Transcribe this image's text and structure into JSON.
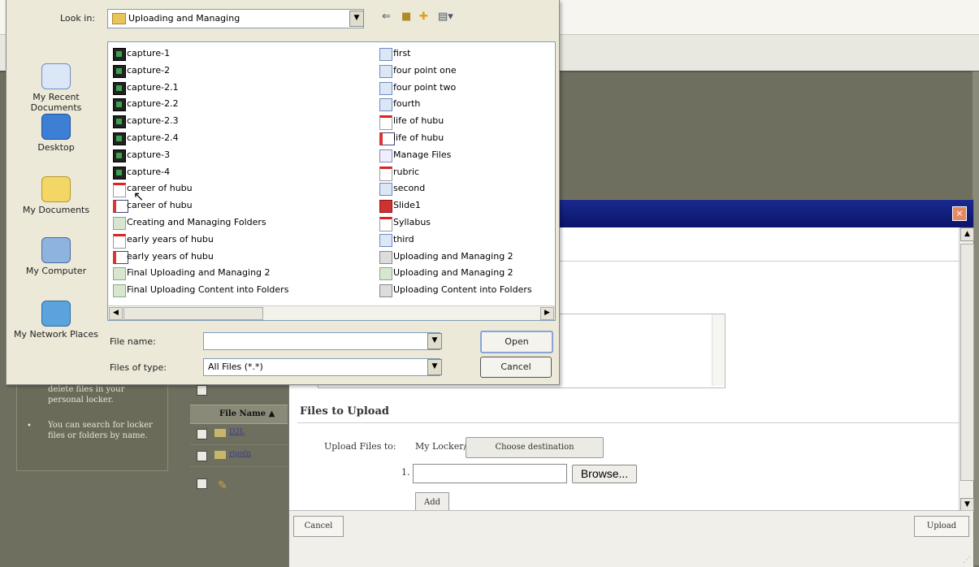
{
  "dialog": {
    "look_in_label": "Look in:",
    "look_in_value": "Uploading and Managing",
    "places": [
      {
        "label": "My Recent Documents"
      },
      {
        "label": "Desktop"
      },
      {
        "label": "My Documents"
      },
      {
        "label": "My Computer"
      },
      {
        "label": "My Network Places"
      }
    ],
    "files_left": [
      {
        "name": "capture-1",
        "type": "cap"
      },
      {
        "name": "capture-2",
        "type": "cap"
      },
      {
        "name": "capture-2.1",
        "type": "cap"
      },
      {
        "name": "capture-2.2",
        "type": "cap"
      },
      {
        "name": "capture-2.3",
        "type": "cap"
      },
      {
        "name": "capture-2.4",
        "type": "cap"
      },
      {
        "name": "capture-3",
        "type": "cap"
      },
      {
        "name": "capture-4",
        "type": "cap"
      },
      {
        "name": "career of hubu",
        "type": "pdf"
      },
      {
        "name": "career of hubu",
        "type": "ppt"
      },
      {
        "name": "Creating and Managing Folders",
        "type": "htm"
      },
      {
        "name": "early years of hubu",
        "type": "pdf"
      },
      {
        "name": "early years of hubu",
        "type": "ppt"
      },
      {
        "name": "Final Uploading and Managing 2",
        "type": "htm"
      },
      {
        "name": "Final Uploading Content into Folders",
        "type": "htm"
      }
    ],
    "files_right": [
      {
        "name": "first",
        "type": "aud"
      },
      {
        "name": "four point one",
        "type": "aud"
      },
      {
        "name": "four point two",
        "type": "aud"
      },
      {
        "name": "fourth",
        "type": "aud"
      },
      {
        "name": "life of hubu",
        "type": "pdf"
      },
      {
        "name": "life of hubu",
        "type": "ppt"
      },
      {
        "name": "Manage Files",
        "type": "doc"
      },
      {
        "name": "rubric",
        "type": "pdf"
      },
      {
        "name": "second",
        "type": "aud"
      },
      {
        "name": "Slide1",
        "type": "img"
      },
      {
        "name": "Syllabus",
        "type": "pdf"
      },
      {
        "name": "third",
        "type": "aud"
      },
      {
        "name": "Uploading and Managing 2",
        "type": "gen"
      },
      {
        "name": "Uploading and Managing 2",
        "type": "htm"
      },
      {
        "name": "Uploading Content into Folders",
        "type": "gen"
      }
    ],
    "file_name_label": "File name:",
    "file_name_value": "",
    "files_of_type_label": "Files of type:",
    "files_of_type_value": "All Files (*.*)",
    "open_label": "Open",
    "cancel_label": "Cancel"
  },
  "upload": {
    "section_title": "Files to Upload",
    "upload_to_label": "Upload Files to:",
    "destination": "My Locker/",
    "choose_destination": "Choose destination",
    "row_number": "1.",
    "browse_label": "Browse...",
    "add_label": "Add",
    "cancel_label": "Cancel",
    "upload_label": "Upload"
  },
  "background": {
    "tip1": "delete files in your personal locker.",
    "tip2": "You can search for locker files or folders by name.",
    "column_header": "File Name ▲",
    "rows": [
      "D2L",
      "ripoln"
    ]
  }
}
